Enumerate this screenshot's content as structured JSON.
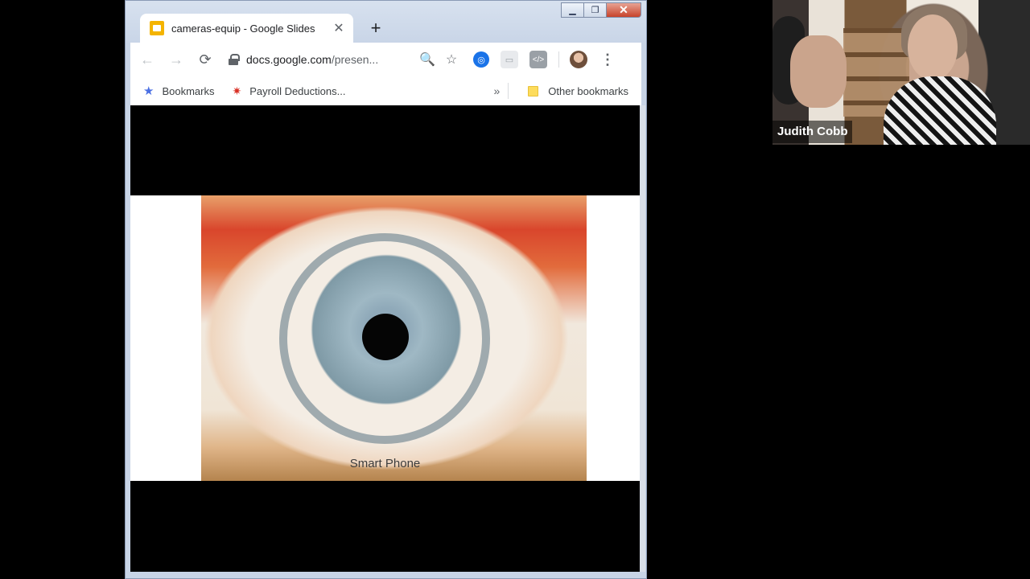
{
  "browser": {
    "tab": {
      "title": "cameras-equip - Google Slides",
      "close": "✕"
    },
    "new_tab": "+",
    "window_controls": {
      "minimize": "▁",
      "maximize": "❐",
      "close": "✕"
    },
    "toolbar": {
      "back": "←",
      "forward": "→",
      "reload": "⟳",
      "url_host": "docs.google.com",
      "url_path": "/presen...",
      "zoom_icon": "🔍",
      "star_icon": "☆",
      "menu": "⋮"
    },
    "bookmarks": {
      "items": [
        {
          "label": "Bookmarks"
        },
        {
          "label": "Payroll Deductions..."
        }
      ],
      "overflow": "»",
      "other": "Other bookmarks"
    }
  },
  "slide": {
    "caption": "Smart Phone"
  },
  "video": {
    "participant_name": "Judith Cobb"
  },
  "colors": {
    "slides_icon": "#f4b400",
    "link_blue": "#1a73e8"
  }
}
